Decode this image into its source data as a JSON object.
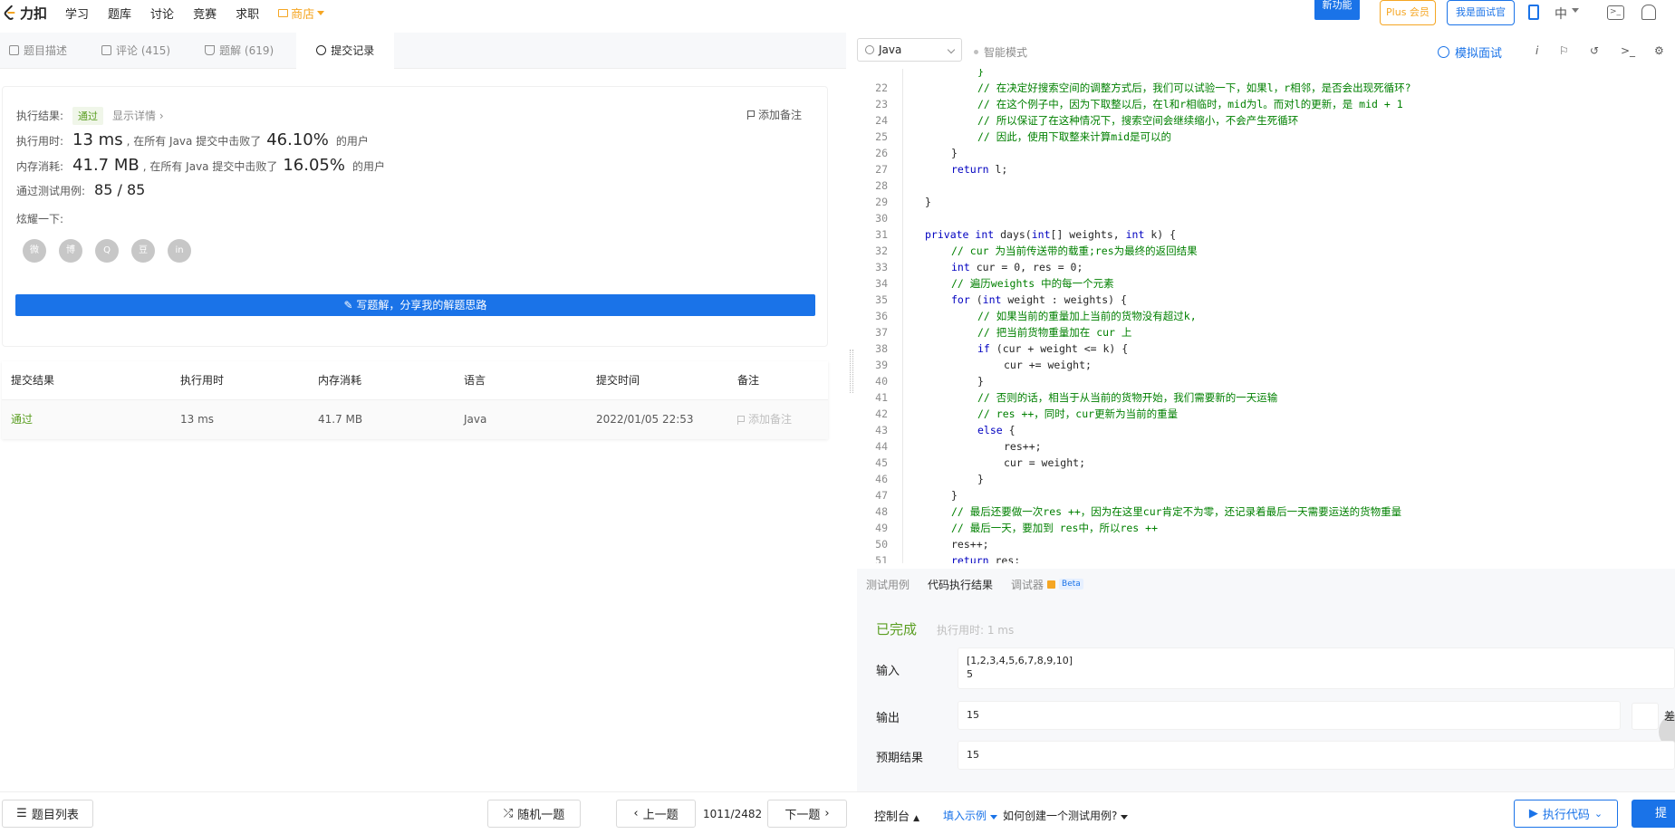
{
  "nav": {
    "logo_text": "力扣",
    "items": [
      "学习",
      "题库",
      "讨论",
      "竞赛",
      "求职"
    ],
    "store": "商店",
    "new_feature": "新功能",
    "plus": "Plus 会员",
    "interviewer": "我是面试官",
    "lang": "中"
  },
  "left_tabs": [
    {
      "label": "题目描述"
    },
    {
      "label": "评论 (415)"
    },
    {
      "label": "题解 (619)"
    },
    {
      "label": "提交记录"
    }
  ],
  "result": {
    "status_label": "执行结果:",
    "status": "通过",
    "show_detail": "显示详情 ›",
    "add_note": "添加备注",
    "time_label": "执行用时:",
    "time_value": "13 ms",
    "time_text": ", 在所有 Java 提交中击败了",
    "time_percent": "46.10%",
    "time_suffix": "的用户",
    "mem_label": "内存消耗:",
    "mem_value": "41.7 MB",
    "mem_text": ", 在所有 Java 提交中击败了",
    "mem_percent": "16.05%",
    "mem_suffix": "的用户",
    "tests_label": "通过测试用例:",
    "tests_value": "85 / 85",
    "share_label": "炫耀一下:",
    "share_icons": [
      "wechat-icon",
      "weibo-icon",
      "qq-icon",
      "douban-icon",
      "linkedin-icon"
    ],
    "share_glyphs": [
      "微",
      "博",
      "Q",
      "豆",
      "in"
    ],
    "write_solution": "写题解，分享我的解题思路"
  },
  "submissions": {
    "headers": [
      "提交结果",
      "执行用时",
      "内存消耗",
      "语言",
      "提交时间",
      "备注"
    ],
    "rows": [
      {
        "status": "通过",
        "time": "13 ms",
        "memory": "41.7 MB",
        "lang": "Java",
        "submitted": "2022/01/05 22:53",
        "note": "添加备注"
      }
    ]
  },
  "bottom": {
    "problem_list": "题目列表",
    "random": "随机一题",
    "prev": "上一题",
    "page": "1011/2482",
    "next": "下一题",
    "console": "控制台",
    "fill_example": "填入示例",
    "howto": "如何创建一个测试用例?",
    "run": "执行代码",
    "submit": "提交"
  },
  "editor_toolbar": {
    "language": "Java",
    "smart_mode": "智能模式",
    "mock_interview": "模拟面试"
  },
  "code_lines": [
    {
      "n": "",
      "indent": 2,
      "parts": [
        [
          "cm",
          "}"
        ]
      ]
    },
    {
      "n": "22",
      "indent": 2,
      "parts": [
        [
          "cm",
          "// 在决定好搜索空间的调整方式后，我们可以试验一下，如果l，r相邻，是否会出现死循环?"
        ]
      ]
    },
    {
      "n": "23",
      "indent": 2,
      "parts": [
        [
          "cm",
          "// 在这个例子中，因为下取整以后，在l和r相临时，mid为l。而对l的更新，是 mid + 1"
        ]
      ]
    },
    {
      "n": "24",
      "indent": 2,
      "parts": [
        [
          "cm",
          "// 所以保证了在这种情况下，搜索空间会继续缩小，不会产生死循环"
        ]
      ]
    },
    {
      "n": "25",
      "indent": 2,
      "parts": [
        [
          "cm",
          "// 因此，使用下取整来计算mid是可以的"
        ]
      ]
    },
    {
      "n": "26",
      "indent": 1,
      "parts": [
        [
          "fn",
          "}"
        ]
      ]
    },
    {
      "n": "27",
      "indent": 1,
      "parts": [
        [
          "kw",
          "return"
        ],
        [
          "fn",
          " l;"
        ]
      ]
    },
    {
      "n": "28",
      "indent": 0,
      "parts": []
    },
    {
      "n": "29",
      "indent": 0,
      "parts": [
        [
          "fn",
          "}"
        ]
      ]
    },
    {
      "n": "30",
      "indent": 0,
      "parts": []
    },
    {
      "n": "31",
      "indent": 0,
      "parts": [
        [
          "kw",
          "private"
        ],
        [
          "fn",
          " "
        ],
        [
          "tp",
          "int"
        ],
        [
          "fn",
          " days("
        ],
        [
          "tp",
          "int"
        ],
        [
          "fn",
          "[] weights, "
        ],
        [
          "tp",
          "int"
        ],
        [
          "fn",
          " k) {"
        ]
      ]
    },
    {
      "n": "32",
      "indent": 1,
      "parts": [
        [
          "cm",
          "// cur 为当前传送带的载重;res为最终的返回结果"
        ]
      ]
    },
    {
      "n": "33",
      "indent": 1,
      "parts": [
        [
          "tp",
          "int"
        ],
        [
          "fn",
          " cur = 0, res = 0;"
        ]
      ]
    },
    {
      "n": "34",
      "indent": 1,
      "parts": [
        [
          "cm",
          "// 遍历weights 中的每一个元素"
        ]
      ]
    },
    {
      "n": "35",
      "indent": 1,
      "parts": [
        [
          "kw",
          "for"
        ],
        [
          "fn",
          " ("
        ],
        [
          "tp",
          "int"
        ],
        [
          "fn",
          " weight : weights) {"
        ]
      ]
    },
    {
      "n": "36",
      "indent": 2,
      "parts": [
        [
          "cm",
          "// 如果当前的重量加上当前的货物没有超过k,"
        ]
      ]
    },
    {
      "n": "37",
      "indent": 2,
      "parts": [
        [
          "cm",
          "// 把当前货物重量加在 cur 上"
        ]
      ]
    },
    {
      "n": "38",
      "indent": 2,
      "parts": [
        [
          "kw",
          "if"
        ],
        [
          "fn",
          " (cur + weight <= k) {"
        ]
      ]
    },
    {
      "n": "39",
      "indent": 3,
      "parts": [
        [
          "fn",
          "cur += weight;"
        ]
      ]
    },
    {
      "n": "40",
      "indent": 2,
      "parts": [
        [
          "fn",
          "}"
        ]
      ]
    },
    {
      "n": "41",
      "indent": 2,
      "parts": [
        [
          "cm",
          "// 否则的话，相当于从当前的货物开始，我们需要新的一天运输"
        ]
      ]
    },
    {
      "n": "42",
      "indent": 2,
      "parts": [
        [
          "cm",
          "// res ++，同时，cur更新为当前的重量"
        ]
      ]
    },
    {
      "n": "43",
      "indent": 2,
      "parts": [
        [
          "kw",
          "else"
        ],
        [
          "fn",
          " {"
        ]
      ]
    },
    {
      "n": "44",
      "indent": 3,
      "parts": [
        [
          "fn",
          "res++;"
        ]
      ]
    },
    {
      "n": "45",
      "indent": 3,
      "parts": [
        [
          "fn",
          "cur = weight;"
        ]
      ]
    },
    {
      "n": "46",
      "indent": 2,
      "parts": [
        [
          "fn",
          "}"
        ]
      ]
    },
    {
      "n": "47",
      "indent": 1,
      "parts": [
        [
          "fn",
          "}"
        ]
      ]
    },
    {
      "n": "48",
      "indent": 1,
      "parts": [
        [
          "cm",
          "// 最后还要做一次res ++，因为在这里cur肯定不为零，还记录着最后一天需要运送的货物重量"
        ]
      ]
    },
    {
      "n": "49",
      "indent": 1,
      "parts": [
        [
          "cm",
          "// 最后一天，要加到 res中，所以res ++"
        ]
      ]
    },
    {
      "n": "50",
      "indent": 1,
      "parts": [
        [
          "fn",
          "res++;"
        ]
      ]
    },
    {
      "n": "51",
      "indent": 1,
      "parts": [
        [
          "kw",
          "return"
        ],
        [
          "fn",
          " res;"
        ]
      ]
    }
  ],
  "panel_tabs": {
    "testcase": "测试用例",
    "result": "代码执行结果",
    "debugger": "调试器",
    "beta": "Beta"
  },
  "run_result": {
    "status": "已完成",
    "exec_time": "执行用时: 1 ms",
    "input_label": "输入",
    "input_value": "[1,2,3,4,5,6,7,8,9,10]\n5",
    "output_label": "输出",
    "output_value": "15",
    "expected_label": "预期结果",
    "expected_value": "15",
    "cut_text": "差"
  },
  "colors": {
    "accent": "#1a73e8",
    "pass": "#5a9e21",
    "store": "#f5a623",
    "comment": "#008000",
    "keyword": "#0000c0"
  }
}
